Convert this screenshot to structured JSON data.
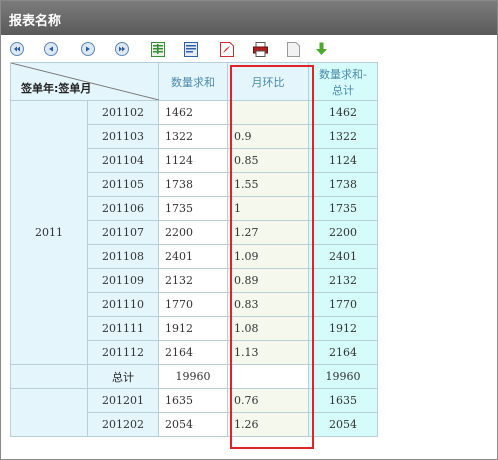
{
  "window": {
    "title": "报表名称"
  },
  "toolbar": {
    "icons": [
      "first-page-icon",
      "prev-page-icon",
      "next-page-icon",
      "last-page-icon",
      "export-excel-icon",
      "export-word-icon",
      "export-pdf-icon",
      "print-icon",
      "blank-page-icon",
      "download-icon"
    ]
  },
  "table": {
    "corner_label": "签单年:签单月",
    "headers": {
      "sum": "数量求和",
      "mom": "月环比",
      "total_line1": "数量求和-",
      "total_line2": "总计"
    },
    "year_2011": "2011",
    "rows_2011": [
      {
        "month": "201102",
        "sum": "1462",
        "mom": "",
        "total": "1462"
      },
      {
        "month": "201103",
        "sum": "1322",
        "mom": "0.9",
        "total": "1322"
      },
      {
        "month": "201104",
        "sum": "1124",
        "mom": "0.85",
        "total": "1124"
      },
      {
        "month": "201105",
        "sum": "1738",
        "mom": "1.55",
        "total": "1738"
      },
      {
        "month": "201106",
        "sum": "1735",
        "mom": "1",
        "total": "1735"
      },
      {
        "month": "201107",
        "sum": "2200",
        "mom": "1.27",
        "total": "2200"
      },
      {
        "month": "201108",
        "sum": "2401",
        "mom": "1.09",
        "total": "2401"
      },
      {
        "month": "201109",
        "sum": "2132",
        "mom": "0.89",
        "total": "2132"
      },
      {
        "month": "201110",
        "sum": "1770",
        "mom": "0.83",
        "total": "1770"
      },
      {
        "month": "201111",
        "sum": "1912",
        "mom": "1.08",
        "total": "1912"
      },
      {
        "month": "201112",
        "sum": "2164",
        "mom": "1.13",
        "total": "2164"
      }
    ],
    "subtotal": {
      "label": "总计",
      "sum": "19960",
      "mom": "",
      "total": "19960"
    },
    "rows_2012": [
      {
        "month": "201201",
        "sum": "1635",
        "mom": "0.76",
        "total": "1635"
      },
      {
        "month": "201202",
        "sum": "2054",
        "mom": "1.26",
        "total": "2054"
      }
    ]
  },
  "colors": {
    "highlight": "#e0222a",
    "titlebar": "#5a5a5a",
    "cell_bg": "#e4f5fb"
  }
}
